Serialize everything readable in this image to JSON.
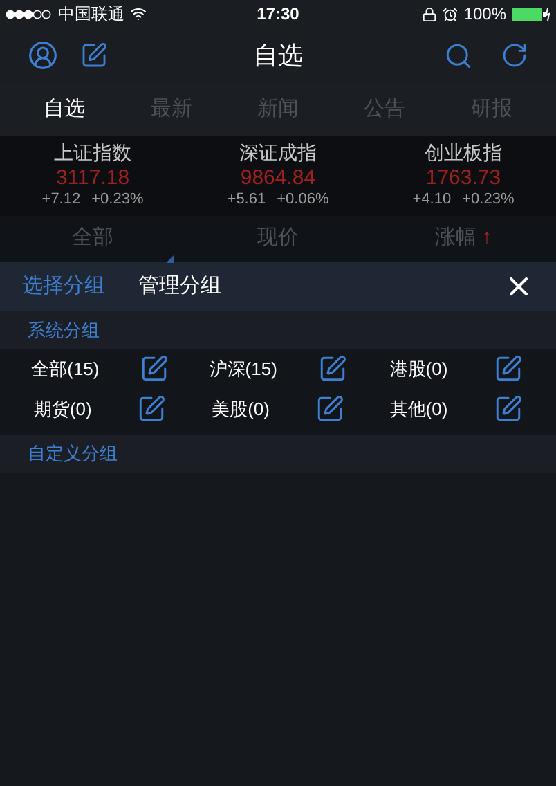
{
  "status_bar": {
    "carrier": "中国联通",
    "time": "17:30",
    "battery": "100%"
  },
  "nav": {
    "title": "自选"
  },
  "tabs": [
    {
      "label": "自选",
      "selected": true
    },
    {
      "label": "最新",
      "selected": false
    },
    {
      "label": "新闻",
      "selected": false
    },
    {
      "label": "公告",
      "selected": false
    },
    {
      "label": "研报",
      "selected": false
    }
  ],
  "indices": [
    {
      "name": "上证指数",
      "value": "3117.18",
      "change": "+7.12",
      "percent": "+0.23%"
    },
    {
      "name": "深证成指",
      "value": "9864.84",
      "change": "+5.61",
      "percent": "+0.06%"
    },
    {
      "name": "创业板指",
      "value": "1763.73",
      "change": "+4.10",
      "percent": "+0.23%"
    }
  ],
  "sort_bar": {
    "group": "全部",
    "price": "现价",
    "change": "涨幅",
    "arrow": "↑"
  },
  "panel": {
    "tabs": [
      {
        "label": "选择分组",
        "selected": false
      },
      {
        "label": "管理分组",
        "selected": true
      }
    ],
    "system_title": "系统分组",
    "groups": [
      {
        "label": "全部(15)"
      },
      {
        "label": "沪深(15)"
      },
      {
        "label": "港股(0)"
      },
      {
        "label": "期货(0)"
      },
      {
        "label": "美股(0)"
      },
      {
        "label": "其他(0)"
      }
    ],
    "custom_title": "自定义分组"
  }
}
